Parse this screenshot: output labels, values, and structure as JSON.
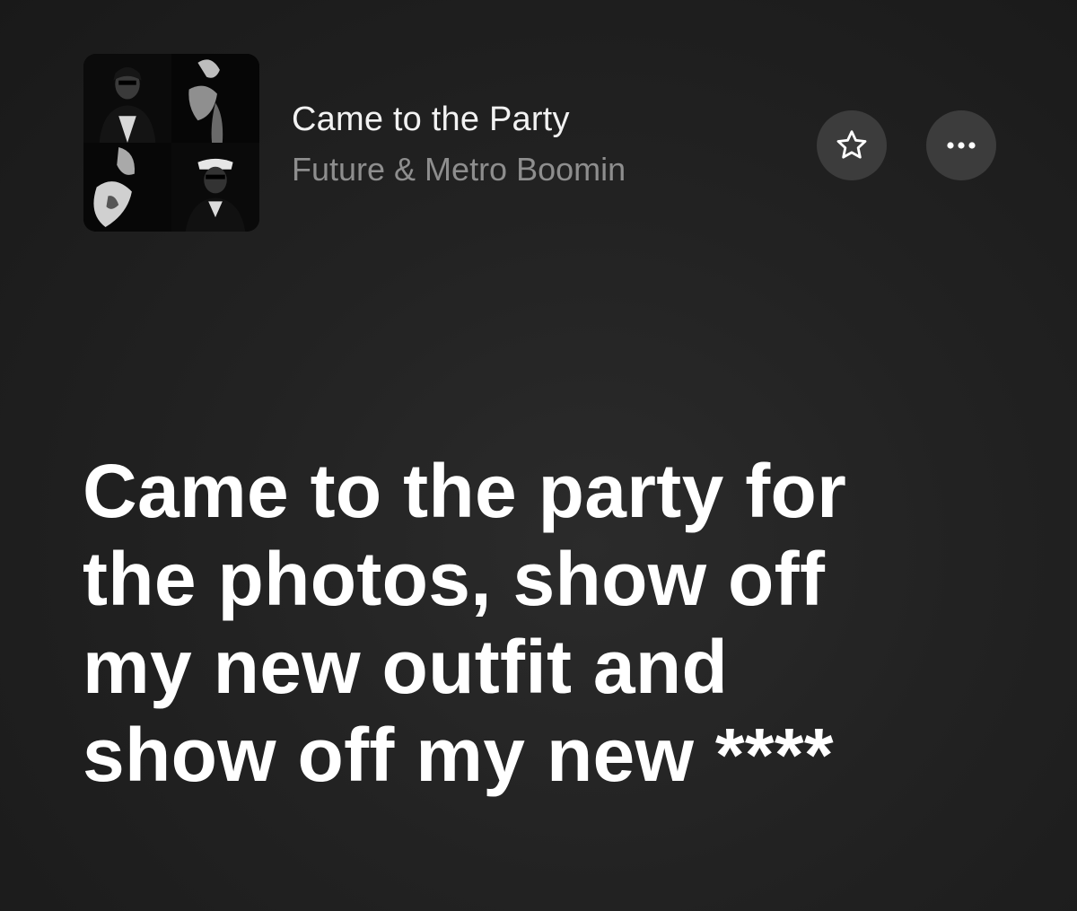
{
  "now_playing": {
    "title": "Came to the Party",
    "artist": "Future & Metro Boomin",
    "artwork_icon": "album-artwork-collage"
  },
  "actions": {
    "favorite_icon": "star-icon",
    "more_icon": "ellipsis-icon"
  },
  "lyrics": {
    "lines": [
      "Came to the party for",
      "the photos, show off",
      "my new outfit and",
      "show off my new ****"
    ]
  },
  "colors": {
    "background": "#222222",
    "button_fill": "#3c3c3c",
    "title_text": "#f2f2f2",
    "artist_text": "#8e8e8e",
    "lyric_text": "#ffffff"
  }
}
